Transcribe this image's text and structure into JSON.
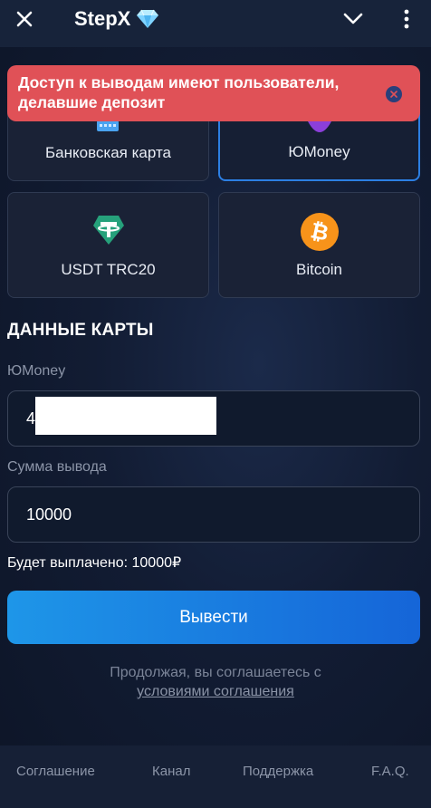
{
  "header": {
    "title": "StepX",
    "close_icon": "close-icon",
    "logo_icon": "diamond-icon",
    "chevron_icon": "chevron-down-icon",
    "menu_icon": "kebab-menu-icon"
  },
  "toast": {
    "message": "Доступ к выводам имеют пользователи, делавшие депозит",
    "close_icon": "close-icon",
    "color": "#e05157"
  },
  "methods": [
    {
      "label": "Банковская карта",
      "icon": "bank-card-icon",
      "selected": false
    },
    {
      "label": "ЮMoney",
      "icon": "yumoney-icon",
      "selected": true
    },
    {
      "label": "USDT TRC20",
      "icon": "tether-icon",
      "selected": false
    },
    {
      "label": "Bitcoin",
      "icon": "bitcoin-icon",
      "selected": false
    }
  ],
  "form": {
    "section_title": "ДАННЫЕ КАРТЫ",
    "wallet_label": "ЮMoney",
    "wallet_value_prefix": "4",
    "amount_label": "Сумма вывода",
    "amount_value": "10000",
    "payout_text": "Будет выплачено: 10000₽"
  },
  "submit": {
    "label": "Вывести"
  },
  "agreement": {
    "text": "Продолжая, вы соглашаетесь с",
    "link": "условиями соглашения"
  },
  "footer": {
    "links": [
      "Соглашение",
      "Канал",
      "Поддержка",
      "F.A.Q."
    ]
  },
  "colors": {
    "accent": "#2c7fe3",
    "button_start": "#1e96e8",
    "button_end": "#1565d8",
    "tether": "#26a17b",
    "bitcoin": "#f7931a"
  }
}
